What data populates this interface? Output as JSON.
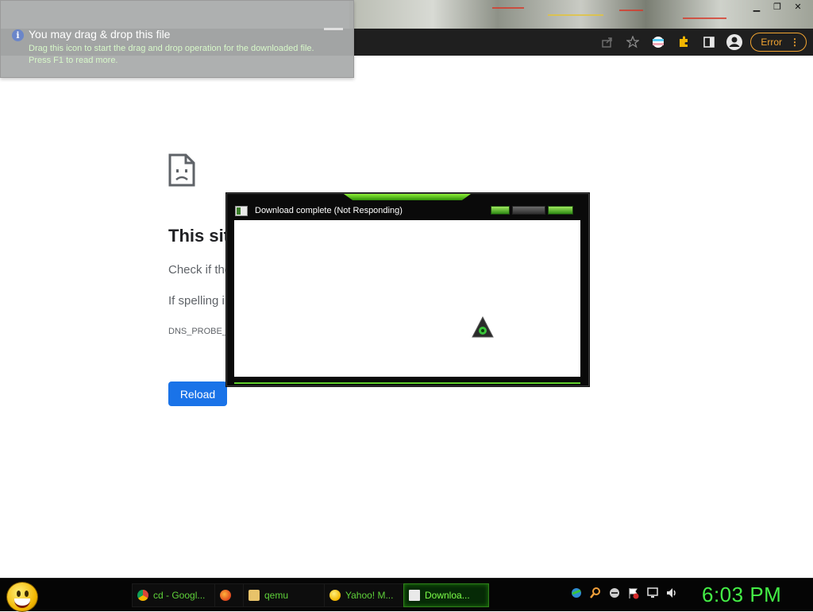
{
  "tooltip": {
    "title": "You may drag & drop this file",
    "line1": "Drag this icon to start the drag and drop operation for the downloaded file.",
    "line2": "Press F1 to read more."
  },
  "browser": {
    "error_button": "Error"
  },
  "error_page": {
    "title": "This sit",
    "check_text": "Check if the",
    "spelling_text": "If spelling i",
    "error_code": "DNS_PROBE_",
    "reload_label": "Reload"
  },
  "dialog": {
    "title": "Download complete (Not Responding)"
  },
  "taskbar": {
    "tasks": [
      {
        "label": "cd - Googl...",
        "icon": "chrome-icon"
      },
      {
        "label": "",
        "icon": "firefox-icon"
      },
      {
        "label": "qemu",
        "icon": "folder-icon"
      },
      {
        "label": "Yahoo! M...",
        "icon": "yahoo-messenger-icon"
      },
      {
        "label": "Downloa...",
        "icon": "download-window-icon"
      }
    ],
    "clock": "6:03 PM"
  },
  "colors": {
    "accent_green": "#44f046",
    "error_orange": "#f3a531",
    "reload_blue": "#1a73e8"
  }
}
